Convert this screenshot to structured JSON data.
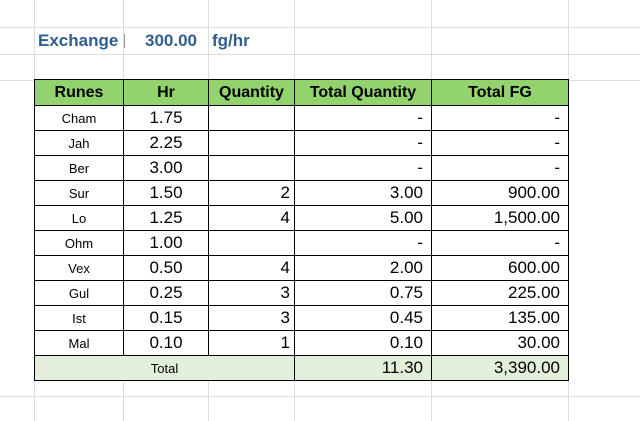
{
  "exchange": {
    "label": "Exchange",
    "value": "300.00",
    "unit": "fg/hr"
  },
  "table": {
    "headers": [
      "Runes",
      "Hr",
      "Quantity",
      "Total Quantity",
      "Total FG"
    ],
    "rows": [
      {
        "rune": "Cham",
        "hr": "1.75",
        "qty": "",
        "total_qty": "-",
        "total_fg": "-"
      },
      {
        "rune": "Jah",
        "hr": "2.25",
        "qty": "",
        "total_qty": "-",
        "total_fg": "-"
      },
      {
        "rune": "Ber",
        "hr": "3.00",
        "qty": "",
        "total_qty": "-",
        "total_fg": "-"
      },
      {
        "rune": "Sur",
        "hr": "1.50",
        "qty": "2",
        "total_qty": "3.00",
        "total_fg": "900.00"
      },
      {
        "rune": "Lo",
        "hr": "1.25",
        "qty": "4",
        "total_qty": "5.00",
        "total_fg": "1,500.00"
      },
      {
        "rune": "Ohm",
        "hr": "1.00",
        "qty": "",
        "total_qty": "-",
        "total_fg": "-"
      },
      {
        "rune": "Vex",
        "hr": "0.50",
        "qty": "4",
        "total_qty": "2.00",
        "total_fg": "600.00"
      },
      {
        "rune": "Gul",
        "hr": "0.25",
        "qty": "3",
        "total_qty": "0.75",
        "total_fg": "225.00"
      },
      {
        "rune": "Ist",
        "hr": "0.15",
        "qty": "3",
        "total_qty": "0.45",
        "total_fg": "135.00"
      },
      {
        "rune": "Mal",
        "hr": "0.10",
        "qty": "1",
        "total_qty": "0.10",
        "total_fg": "30.00"
      }
    ],
    "total": {
      "label": "Total",
      "total_qty": "11.30",
      "total_fg": "3,390.00"
    }
  },
  "colors": {
    "header_fill": "#92d36e",
    "total_fill": "#e2efda",
    "exchange_text": "#2f5e8f"
  }
}
